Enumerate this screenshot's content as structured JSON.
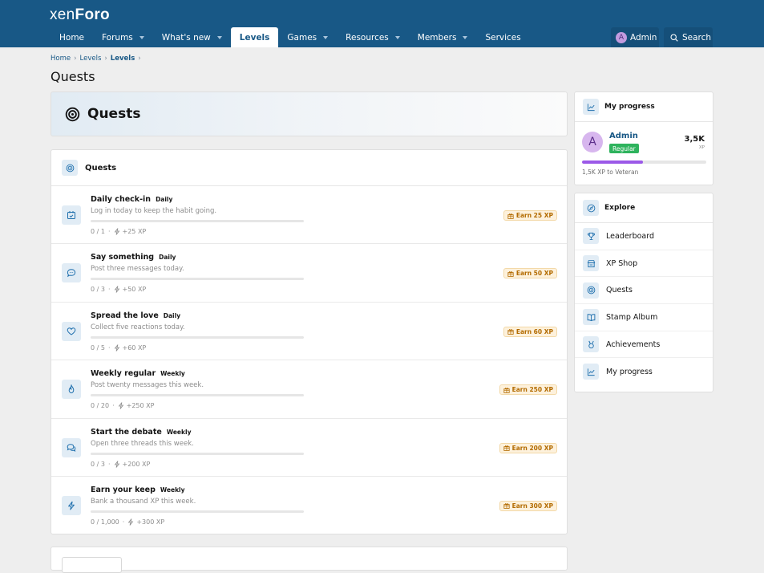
{
  "header": {
    "logo_prefix": "xen",
    "logo_suffix": "Foro",
    "nav": [
      {
        "label": "Home",
        "dropdown": false,
        "active": false
      },
      {
        "label": "Forums",
        "dropdown": true,
        "active": false
      },
      {
        "label": "What's new",
        "dropdown": true,
        "active": false
      },
      {
        "label": "Levels",
        "dropdown": false,
        "active": true
      },
      {
        "label": "Games",
        "dropdown": true,
        "active": false
      },
      {
        "label": "Resources",
        "dropdown": true,
        "active": false
      },
      {
        "label": "Members",
        "dropdown": true,
        "active": false
      },
      {
        "label": "Services",
        "dropdown": false,
        "active": false
      }
    ],
    "user_initial": "A",
    "user_label": "Admin",
    "search_label": "Search"
  },
  "breadcrumb": [
    "Home",
    "Levels",
    "Levels"
  ],
  "page_title": "Quests",
  "hero_title": "Quests",
  "quests": {
    "title": "Quests",
    "items": [
      {
        "icon": "calendar-check-icon",
        "name": "Daily check-in",
        "freq": "Daily",
        "desc": "Log in today to keep the habit going.",
        "progress": "0 / 1",
        "xp": "+25 XP",
        "reward": "Earn 25 XP"
      },
      {
        "icon": "chat-bubble-icon",
        "name": "Say something",
        "freq": "Daily",
        "desc": "Post three messages today.",
        "progress": "0 / 3",
        "xp": "+50 XP",
        "reward": "Earn 50 XP"
      },
      {
        "icon": "heart-icon",
        "name": "Spread the love",
        "freq": "Daily",
        "desc": "Collect five reactions today.",
        "progress": "0 / 5",
        "xp": "+60 XP",
        "reward": "Earn 60 XP"
      },
      {
        "icon": "flame-icon",
        "name": "Weekly regular",
        "freq": "Weekly",
        "desc": "Post twenty messages this week.",
        "progress": "0 / 20",
        "xp": "+250 XP",
        "reward": "Earn 250 XP"
      },
      {
        "icon": "chat-bubbles-icon",
        "name": "Start the debate",
        "freq": "Weekly",
        "desc": "Open three threads this week.",
        "progress": "0 / 3",
        "xp": "+200 XP",
        "reward": "Earn 200 XP"
      },
      {
        "icon": "bolt-icon",
        "name": "Earn your keep",
        "freq": "Weekly",
        "desc": "Bank a thousand XP this week.",
        "progress": "0 / 1,000",
        "xp": "+300 XP",
        "reward": "Earn 300 XP"
      }
    ]
  },
  "progress_card": {
    "title": "My progress",
    "initial": "A",
    "name": "Admin",
    "rank": "Regular",
    "xp": "3,5K",
    "xp_label": "XP",
    "progress_fraction": 0.49,
    "next_text": "1,5K XP to Veteran"
  },
  "explore": {
    "title": "Explore",
    "items": [
      {
        "icon": "trophy-icon",
        "label": "Leaderboard"
      },
      {
        "icon": "shop-icon",
        "label": "XP Shop"
      },
      {
        "icon": "target-icon",
        "label": "Quests"
      },
      {
        "icon": "album-icon",
        "label": "Stamp Album"
      },
      {
        "icon": "medal-icon",
        "label": "Achievements"
      },
      {
        "icon": "chart-icon",
        "label": "My progress"
      }
    ]
  },
  "colors": {
    "header_bg": "#185886",
    "link": "#185886",
    "accent_purple": "#9b59e8",
    "rank_green": "#2eb35d",
    "earn_text": "#b36b00"
  }
}
